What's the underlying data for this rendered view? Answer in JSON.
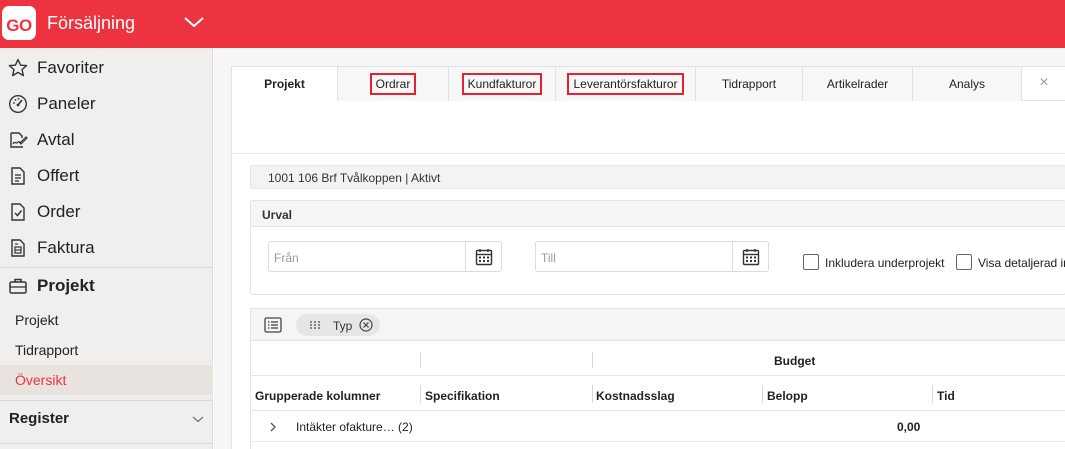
{
  "app": {
    "logo_text": "GO",
    "title": "Försäljning",
    "brand_color": "#ee3340"
  },
  "sidebar": {
    "items": [
      {
        "label": "Favoriter",
        "icon": "star-icon"
      },
      {
        "label": "Paneler",
        "icon": "gauge-icon"
      },
      {
        "label": "Avtal",
        "icon": "signature-icon"
      },
      {
        "label": "Offert",
        "icon": "document-icon"
      },
      {
        "label": "Order",
        "icon": "order-check-icon"
      },
      {
        "label": "Faktura",
        "icon": "invoice-icon"
      },
      {
        "label": "Projekt",
        "icon": "briefcase-icon"
      }
    ],
    "subitems": [
      {
        "label": "Projekt"
      },
      {
        "label": "Tidrapport"
      },
      {
        "label": "Översikt",
        "active": true
      }
    ],
    "register_label": "Register"
  },
  "tabs": [
    {
      "label": "Projekt",
      "active": true
    },
    {
      "label": "Ordrar",
      "highlighted": true
    },
    {
      "label": "Kundfakturor",
      "highlighted": true
    },
    {
      "label": "Leverantörsfakturor",
      "highlighted": true
    },
    {
      "label": "Tidrapport"
    },
    {
      "label": "Artikelrader"
    },
    {
      "label": "Analys"
    }
  ],
  "tab_close": "×",
  "project_bar": "1001 106 Brf Tvålkoppen | Aktivt",
  "urval": {
    "title": "Urval",
    "from_placeholder": "Från",
    "to_placeholder": "Till",
    "include_subprojects": "Inkludera underprojekt",
    "show_detailed": "Visa detaljerad in"
  },
  "grid": {
    "chip_label": "Typ",
    "group_header": "Budget",
    "columns": [
      "Grupperade kolumner",
      "Specifikation",
      "Kostnadsslag",
      "Belopp",
      "Tid"
    ],
    "rows": [
      {
        "name": "Intäkter ofakture…  (2)",
        "amount": "0,00"
      }
    ]
  }
}
